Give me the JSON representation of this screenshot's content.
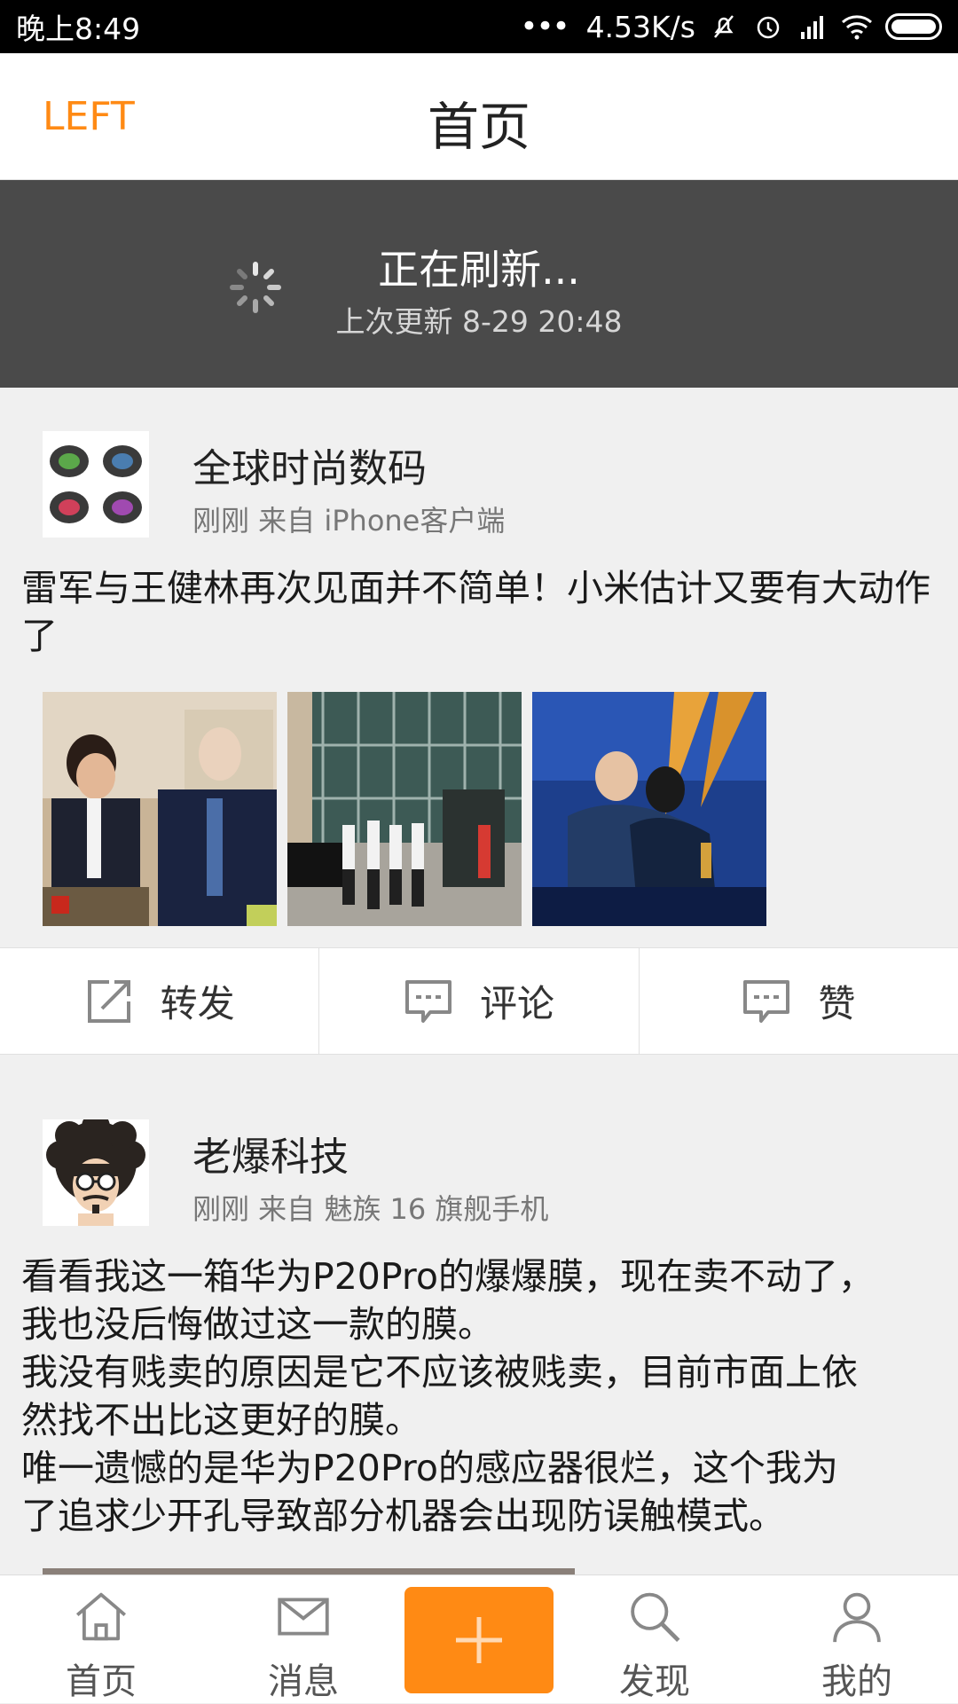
{
  "status_bar": {
    "time": "晚上8:49",
    "network_speed": "4.53K/s"
  },
  "header": {
    "left_label": "LEFT",
    "title": "首页"
  },
  "refresh": {
    "status": "正在刷新...",
    "last_update": "上次更新 8-29 20:48"
  },
  "posts": [
    {
      "username": "全球时尚数码",
      "meta": "刚刚 来自 iPhone客户端",
      "text": "雷军与王健林再次见面并不简单！小米估计又要有大动作了"
    },
    {
      "username": "老爆科技",
      "meta": "刚刚 来自 魅族 16 旗舰手机",
      "text_lines": [
        "看看我这一箱华为P20Pro的爆爆膜，现在卖不动了，",
        "我也没后悔做过这一款的膜。",
        "我没有贱卖的原因是它不应该被贱卖，目前市面上依",
        "然找不出比这更好的膜。",
        "唯一遗憾的是华为P20Pro的感应器很烂，这个我为",
        "了追求少开孔导致部分机器会出现防误触模式。"
      ]
    }
  ],
  "actions": {
    "repost": "转发",
    "comment": "评论",
    "like": "赞"
  },
  "tabs": {
    "home": "首页",
    "messages": "消息",
    "discover": "发现",
    "me": "我的"
  },
  "colors": {
    "accent": "#ff8a14",
    "refresh_bg": "#4a4a4a"
  }
}
